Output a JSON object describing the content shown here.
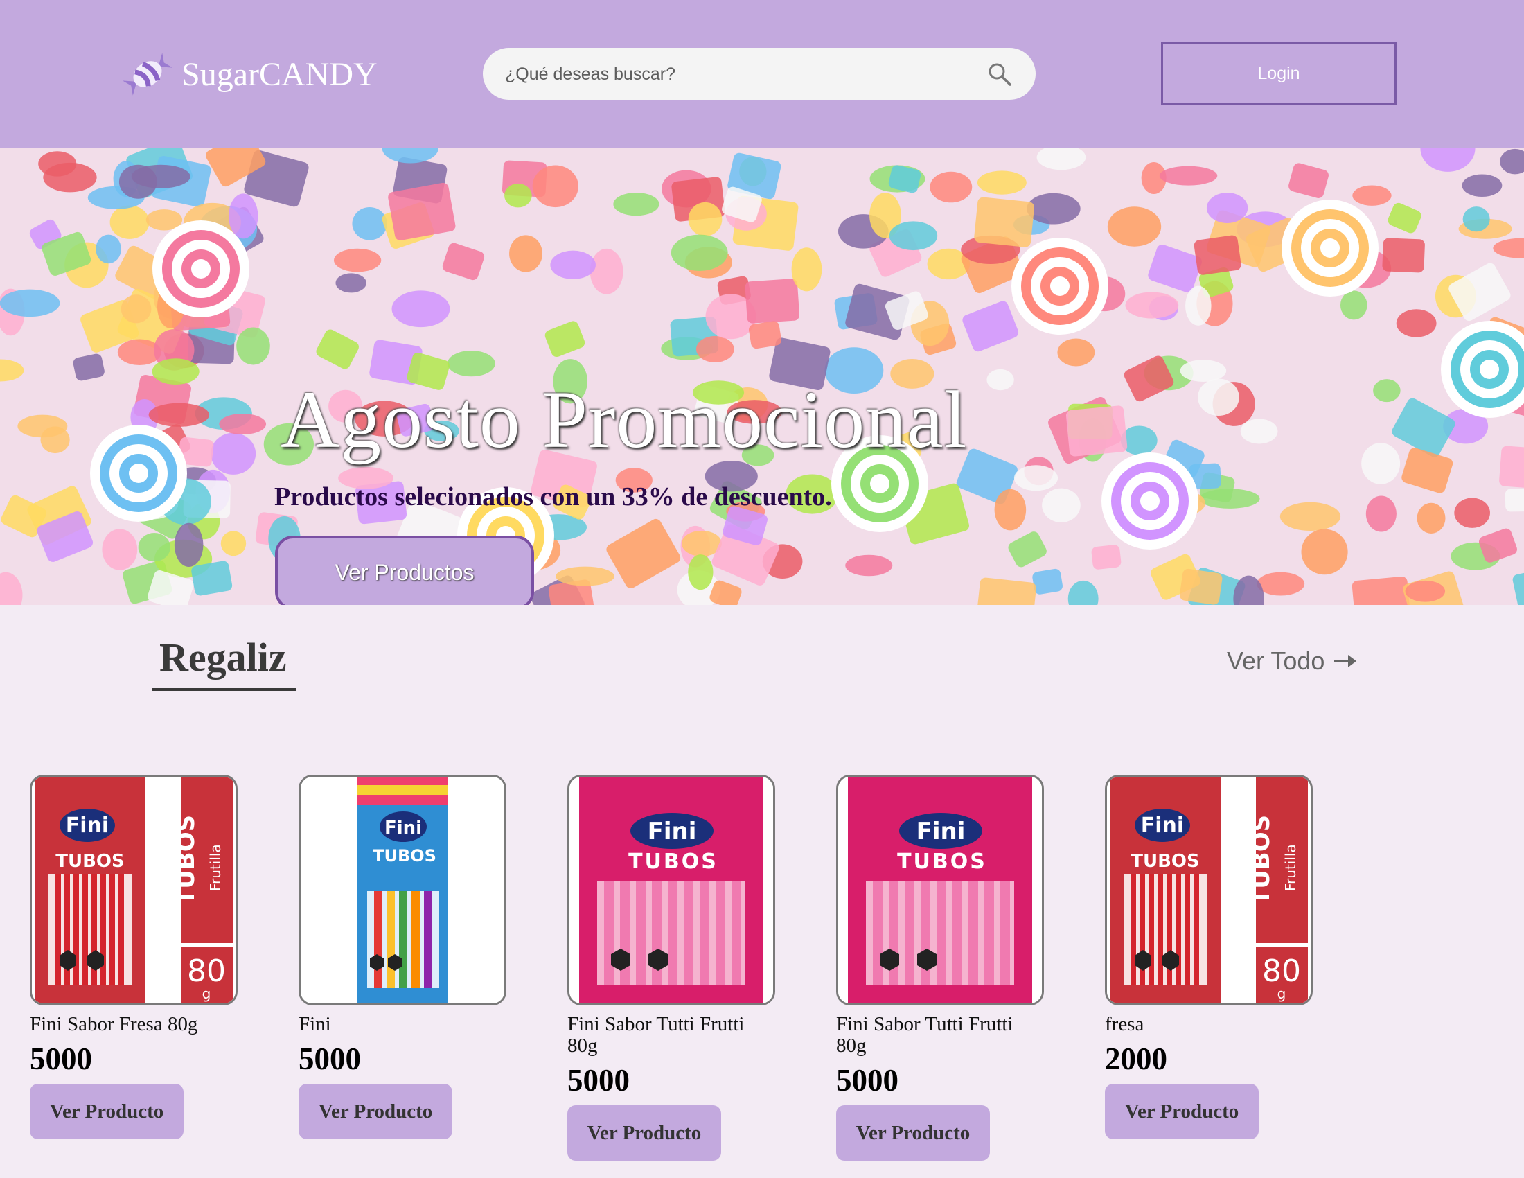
{
  "header": {
    "logo_text": "SugarCANDY",
    "search_placeholder": "¿Qué deseas buscar?",
    "login_label": "Login",
    "background_color": "#c3a9de"
  },
  "hero": {
    "title": "Agosto Promocional",
    "subtitle": "Productos selecionados con un 33% de descuento.",
    "button_label": "Ver Productos"
  },
  "section": {
    "title": "Regaliz",
    "view_all_label": "Ver Todo"
  },
  "products": [
    {
      "name": "Fini Sabor Fresa 80g",
      "price": "5000",
      "button": "Ver Producto",
      "package": "red-tubos"
    },
    {
      "name": "Fini",
      "price": "5000",
      "button": "Ver Producto",
      "package": "blue-tubos"
    },
    {
      "name": "Fini Sabor Tutti Frutti 80g",
      "price": "5000",
      "button": "Ver Producto",
      "package": "pink-tubos"
    },
    {
      "name": "Fini Sabor Tutti Frutti 80g",
      "price": "5000",
      "button": "Ver Producto",
      "package": "pink-tubos"
    },
    {
      "name": "fresa",
      "price": "2000",
      "button": "Ver Producto",
      "package": "red-tubos"
    }
  ],
  "package_text": {
    "brand": "Fini",
    "tubos": "TUBOS",
    "flavor_vertical": "Frutilla",
    "weight_value": "80",
    "weight_unit": "g"
  }
}
